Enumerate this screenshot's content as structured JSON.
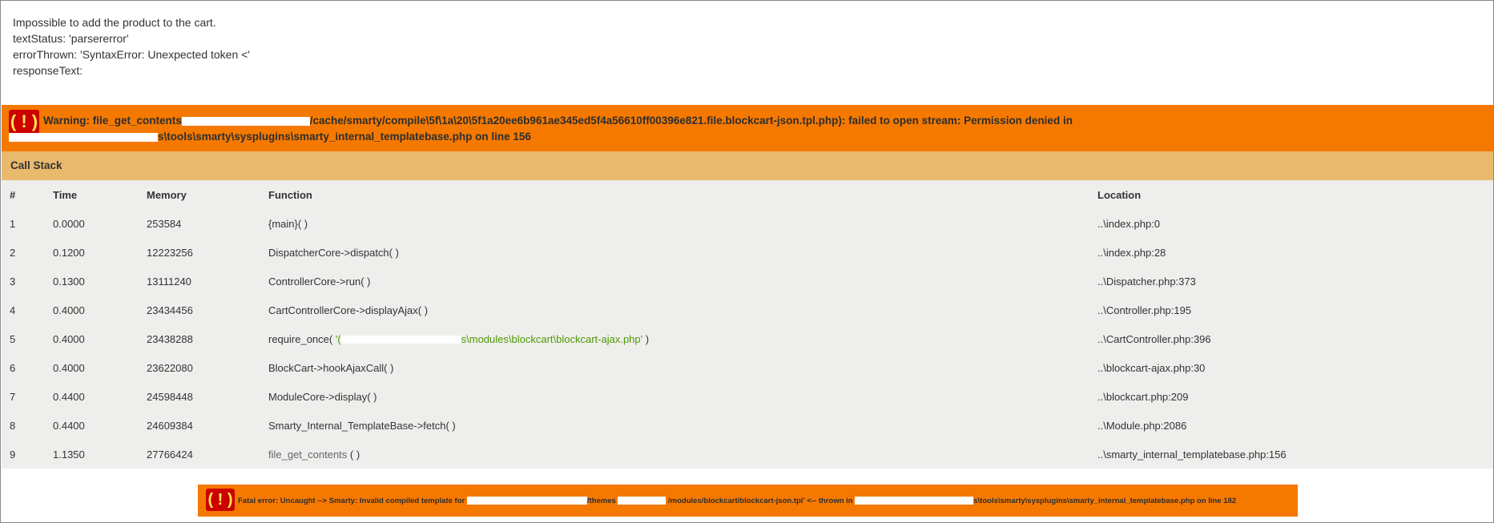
{
  "message": {
    "line1": "Impossible to add the product to the cart.",
    "line2": "textStatus: 'parsererror'",
    "line3": "errorThrown: 'SyntaxError: Unexpected token <'",
    "line4": "responseText:"
  },
  "warning": {
    "icon": "( ! )",
    "prefix": "Warning: file_get_contents",
    "path": "/cache/smarty/compile\\5f\\1a\\20\\5f1a20ee6b961ae345ed5f4a56610ff00396e821.file.blockcart-json.tpl.php): failed to open stream: Permission denied in",
    "line2": "s\\tools\\smarty\\sysplugins\\smarty_internal_templatebase.php on line 156"
  },
  "call_stack": {
    "title": "Call Stack",
    "headers": [
      "#",
      "Time",
      "Memory",
      "Function",
      "Location"
    ],
    "rows": [
      {
        "n": "1",
        "time": "0.0000",
        "mem": "253584",
        "func": "{main}( )",
        "loc": "..\\index.php:0"
      },
      {
        "n": "2",
        "time": "0.1200",
        "mem": "12223256",
        "func": "DispatcherCore->dispatch( )",
        "loc": "..\\index.php:28"
      },
      {
        "n": "3",
        "time": "0.1300",
        "mem": "13111240",
        "func": "ControllerCore->run( )",
        "loc": "..\\Dispatcher.php:373"
      },
      {
        "n": "4",
        "time": "0.4000",
        "mem": "23434456",
        "func": "CartControllerCore->displayAjax( )",
        "loc": "..\\Controller.php:195"
      },
      {
        "n": "5",
        "time": "0.4000",
        "mem": "23438288",
        "func_prefix": "require_once( ",
        "func_arg_start": "'(",
        "func_arg_end": "s\\modules\\blockcart\\blockcart-ajax.php'",
        "func_suffix": " )",
        "loc": "..\\CartController.php:396"
      },
      {
        "n": "6",
        "time": "0.4000",
        "mem": "23622080",
        "func": "BlockCart->hookAjaxCall( )",
        "loc": "..\\blockcart-ajax.php:30"
      },
      {
        "n": "7",
        "time": "0.4400",
        "mem": "24598448",
        "func": "ModuleCore->display( )",
        "loc": "..\\blockcart.php:209"
      },
      {
        "n": "8",
        "time": "0.4400",
        "mem": "24609384",
        "func": "Smarty_Internal_TemplateBase->fetch( )",
        "loc": "..\\Module.php:2086"
      },
      {
        "n": "9",
        "time": "1.1350",
        "mem": "27766424",
        "func": "file_get_contents",
        "func_suffix": " ( )",
        "loc": "..\\smarty_internal_templatebase.php:156"
      }
    ]
  },
  "fatal": {
    "icon": "( ! )",
    "part1": "Fatal error: Uncaught --> Smarty: Invalid compiled template for",
    "part2": "/themes",
    "part3": "/modules/blockcart/blockcart-json.tpl' <-- thrown in",
    "part4": "s\\tools\\smarty\\sysplugins\\smarty_internal_templatebase.php on line 182"
  },
  "colors": {
    "warning_bg": "#f57900",
    "callstack_title_bg": "#e9b96e",
    "table_bg": "#eeeeec",
    "icon_bg": "#cc0000",
    "icon_fg": "#fce94f",
    "string_green": "#4e9a06"
  }
}
